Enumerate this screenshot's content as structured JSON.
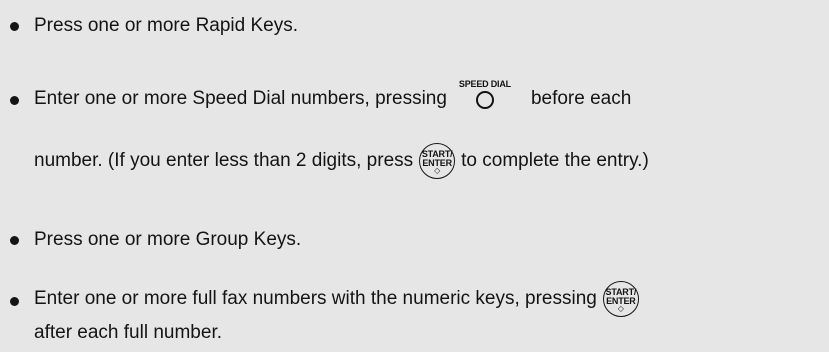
{
  "items": [
    {
      "text": "Press one or more Rapid Keys."
    },
    {
      "text_before": "Enter one or more Speed Dial numbers, pressing",
      "text_after": "before each",
      "continuation_before": "number. (If you enter less than 2 digits, press",
      "continuation_after": "to complete the entry.)"
    },
    {
      "text": "Press one or more Group Keys."
    },
    {
      "text_before": "Enter one or more full fax numbers with the numeric keys, pressing",
      "continuation": "after each full number."
    }
  ],
  "keys": {
    "speed_dial_label": "SPEED DIAL",
    "start_line1": "START/",
    "start_line2": "ENTER",
    "start_symbol": "◇"
  },
  "colors": {
    "background": "#e6e6e6",
    "text": "#141414"
  }
}
